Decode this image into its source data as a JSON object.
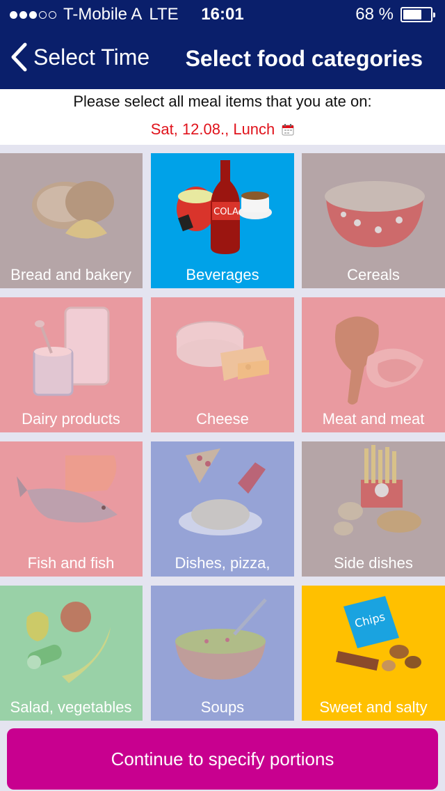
{
  "status_bar": {
    "carrier": "T-Mobile A",
    "network": "LTE",
    "time": "16:01",
    "battery_text": "68 %",
    "battery_level": 0.68,
    "signal_bars_filled": 3,
    "signal_bars_total": 5
  },
  "nav": {
    "back_label": "Select Time",
    "title": "Select food categories",
    "back_icon": "chevron-left-icon",
    "color": "#0a1f6b"
  },
  "info": {
    "prompt": "Please select all meal items that you ate on:",
    "date": "Sat, 12.08., Lunch",
    "date_color": "#e0121b",
    "date_icon": "calendar-icon"
  },
  "categories": [
    {
      "label": "Bread and bakery",
      "color": "#b5a5a7",
      "selected": false,
      "icon": "bread-icon"
    },
    {
      "label": "Beverages",
      "color": "#00a2e8",
      "selected": true,
      "icon": "cola-bottle-icon"
    },
    {
      "label": "Cereals",
      "color": "#b5a5a7",
      "selected": false,
      "icon": "cereal-bowl-icon"
    },
    {
      "label": "Dairy products",
      "color": "#e99aa0",
      "selected": false,
      "icon": "milk-glass-icon"
    },
    {
      "label": "Cheese",
      "color": "#e99aa0",
      "selected": false,
      "icon": "cheese-icon"
    },
    {
      "label": "Meat and meat",
      "color": "#e99aa0",
      "selected": false,
      "icon": "meat-icon"
    },
    {
      "label": "Fish and fish",
      "color": "#e99aa0",
      "selected": false,
      "icon": "fish-icon"
    },
    {
      "label": "Dishes, pizza,",
      "color": "#96a3d6",
      "selected": false,
      "icon": "pasta-pizza-icon"
    },
    {
      "label": "Side dishes",
      "color": "#b5a5a7",
      "selected": false,
      "icon": "fries-potato-icon"
    },
    {
      "label": "Salad, vegetables",
      "color": "#99d1a7",
      "selected": false,
      "icon": "vegetables-icon"
    },
    {
      "label": "Soups",
      "color": "#96a3d6",
      "selected": false,
      "icon": "soup-bowl-icon"
    },
    {
      "label": "Sweet and salty",
      "color": "#ffc000",
      "selected": true,
      "icon": "chips-nuts-icon"
    }
  ],
  "cta": {
    "label": "Continue to specify portions",
    "color": "#c8008f"
  }
}
